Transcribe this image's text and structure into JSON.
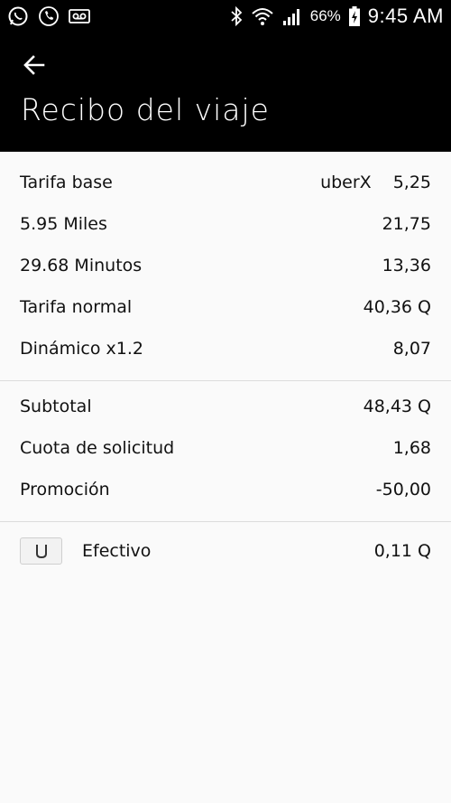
{
  "status_bar": {
    "battery_percent": "66%",
    "time": "9:45 AM",
    "icons": [
      "whatsapp-icon",
      "phone-icon",
      "voicemail-icon",
      "bluetooth-icon",
      "wifi-icon",
      "signal-icon",
      "battery-charging-icon"
    ]
  },
  "header": {
    "back_icon": "arrow-left-icon",
    "title": "Recibo del viaje"
  },
  "fare_breakdown": {
    "base": {
      "label": "Tarifa base",
      "vehicle": "uberX",
      "value": "5,25"
    },
    "distance": {
      "label": "5.95 Miles",
      "value": "21,75"
    },
    "time": {
      "label": "29.68 Minutos",
      "value": "13,36"
    },
    "normal": {
      "label": "Tarifa normal",
      "value": "40,36 Q"
    },
    "surge": {
      "label": "Dinámico x1.2",
      "value": "8,07"
    }
  },
  "totals": {
    "subtotal": {
      "label": "Subtotal",
      "value": "48,43 Q"
    },
    "booking_fee": {
      "label": "Cuota de solicitud",
      "value": "1,68"
    },
    "promotion": {
      "label": "Promoción",
      "value": "-50,00"
    }
  },
  "payment": {
    "icon": "uber-card-icon",
    "method": "Efectivo",
    "value": "0,11 Q"
  },
  "colors": {
    "header_bg": "#000000",
    "page_bg": "#fafafa",
    "divider": "#dcdcdc"
  }
}
